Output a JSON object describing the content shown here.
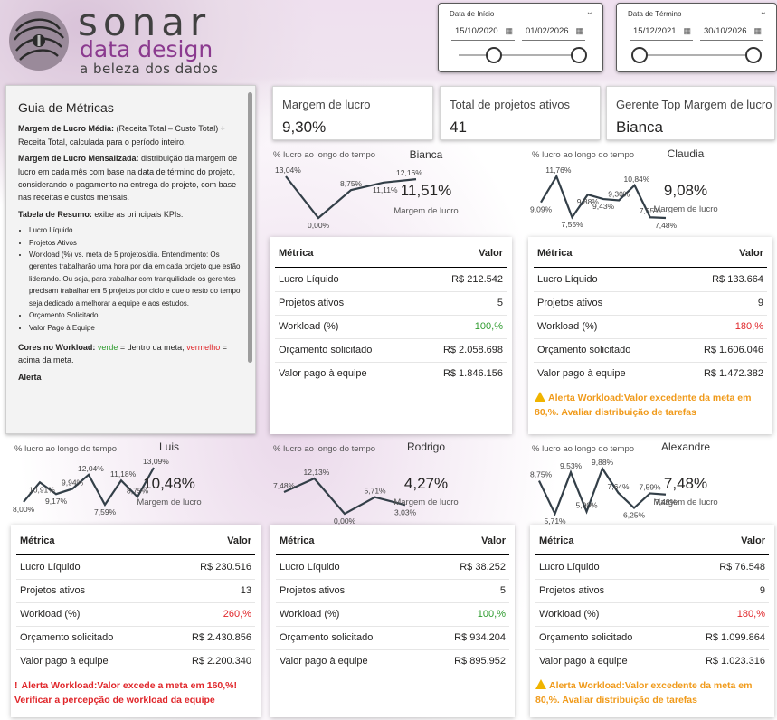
{
  "logo": {
    "word": "sonar",
    "subtitle": "data design",
    "tagline": "a beleza dos dados"
  },
  "slicer_start": {
    "label": "Data de Início",
    "from": "15/10/2020",
    "to": "01/02/2026"
  },
  "slicer_end": {
    "label": "Data de Término",
    "from": "15/12/2021",
    "to": "30/10/2026"
  },
  "guide": {
    "title": "Guia de Métricas",
    "p1_bold": "Margem de Lucro Média:",
    "p1": " (Receita Total – Custo Total) ÷ Receita Total, calculada para o período inteiro.",
    "p2_bold": "Margem de Lucro Mensalizada:",
    "p2": " distribuição da margem de lucro em cada mês com base na data de término do projeto, considerando o pagamento na entrega do projeto, com base nas receitas e custos mensais.",
    "p3_bold": "Tabela de Resumo:",
    "p3": " exibe as principais KPIs:",
    "bullets": [
      "Lucro Líquido",
      "Projetos Ativos",
      "Workload (%) vs. meta de 5 projetos/dia. Entendimento: Os gerentes trabalharão uma hora por dia em cada projeto que estão liderando. Ou seja, para trabalhar com tranquilidade os gerentes precisam trabalhar em 5 projetos por ciclo e que o resto do tempo seja dedicado a melhorar a equipe e aos estudos.",
      "Orçamento Solicitado",
      "Valor Pago à Equipe"
    ],
    "p4_bold": "Cores no Workload:",
    "p4a": " ",
    "green_word": "verde",
    "p4b": " = dentro da meta;",
    "red_word": "vermelho",
    "p4c": " = acima da meta.",
    "p5": "Alerta"
  },
  "kpis": [
    {
      "title": "Margem de lucro",
      "value": "9,30%"
    },
    {
      "title": "Total de projetos ativos",
      "value": "41"
    },
    {
      "title": "Gerente Top Margem de lucro",
      "value": "Bianca"
    }
  ],
  "spark_title": "% lucro ao longo do tempo",
  "margin_label": "Margem de lucro",
  "table_headers": {
    "metric": "Métrica",
    "value": "Valor"
  },
  "row_labels": [
    "Lucro Líquido",
    "Projetos ativos",
    "Workload (%)",
    "Orçamento solicitado",
    "Valor pago à equipe"
  ],
  "managers": [
    {
      "name": "Bianca",
      "margin": "11,51%",
      "spark": [
        13.04,
        0.0,
        8.75,
        11.11,
        12.16
      ],
      "labels": [
        "13,04%",
        "0,00%",
        "8,75%",
        "11,11%",
        "12,16%"
      ],
      "values": [
        "R$ 212.542",
        "5",
        "100,%",
        "R$ 2.058.698",
        "R$ 1.846.156"
      ],
      "workload_status": "green",
      "alert": ""
    },
    {
      "name": "Claudia",
      "margin": "9,08%",
      "spark": [
        9.09,
        11.76,
        7.55,
        9.88,
        9.43,
        9.3,
        10.84,
        7.55,
        7.48
      ],
      "labels": [
        "9,09%",
        "11,76%",
        "7,55%",
        "9,88%",
        "9,43%",
        "9,30%",
        "10,84%",
        "7,55%",
        "7,48%"
      ],
      "values": [
        "R$ 133.664",
        "9",
        "180,%",
        "R$ 1.606.046",
        "R$ 1.472.382"
      ],
      "workload_status": "red",
      "alert": "Alerta Workload:Valor excedente da meta em 80,%. Avaliar distribuição de tarefas",
      "alert_type": "warning"
    },
    {
      "name": "Luis",
      "margin": "10,48%",
      "spark": [
        8.0,
        10.91,
        9.17,
        9.94,
        12.04,
        7.59,
        11.18,
        8.75,
        13.09
      ],
      "labels": [
        "8,00%",
        "10,91%",
        "9,17%",
        "9,94%",
        "12,04%",
        "7,59%",
        "11,18%",
        "8,75%",
        "13,09%"
      ],
      "values": [
        "R$ 230.516",
        "13",
        "260,%",
        "R$ 2.430.856",
        "R$ 2.200.340"
      ],
      "workload_status": "red",
      "alert": "Alerta Workload:Valor excede a meta em 160,%! Verificar a percepção de workload da equipe",
      "alert_type": "critical"
    },
    {
      "name": "Rodrigo",
      "margin": "4,27%",
      "spark": [
        7.48,
        12.13,
        0.0,
        5.71,
        3.03
      ],
      "labels": [
        "7,48%",
        "12,13%",
        "0,00%",
        "5,71%",
        "3,03%"
      ],
      "values": [
        "R$ 38.252",
        "5",
        "100,%",
        "R$ 934.204",
        "R$ 895.952"
      ],
      "workload_status": "green",
      "alert": ""
    },
    {
      "name": "Alexandre",
      "margin": "7,48%",
      "spark": [
        8.75,
        5.71,
        9.53,
        5.9,
        9.88,
        7.64,
        6.25,
        7.59,
        7.48
      ],
      "labels": [
        "8,75%",
        "5,71%",
        "9,53%",
        "5,90%",
        "9,88%",
        "7,64%",
        "6,25%",
        "7,59%",
        "7,48%"
      ],
      "values": [
        "R$ 76.548",
        "9",
        "180,%",
        "R$ 1.099.864",
        "R$ 1.023.316"
      ],
      "workload_status": "red",
      "alert": "Alerta Workload:Valor excedente da meta em 80,%. Avaliar distribuição de tarefas",
      "alert_type": "warning"
    }
  ],
  "colors": {
    "green": "#2e9b2e",
    "red": "#e0262a",
    "orange": "#f09a1a",
    "accent": "#8b3a8f",
    "line": "#333f48"
  }
}
